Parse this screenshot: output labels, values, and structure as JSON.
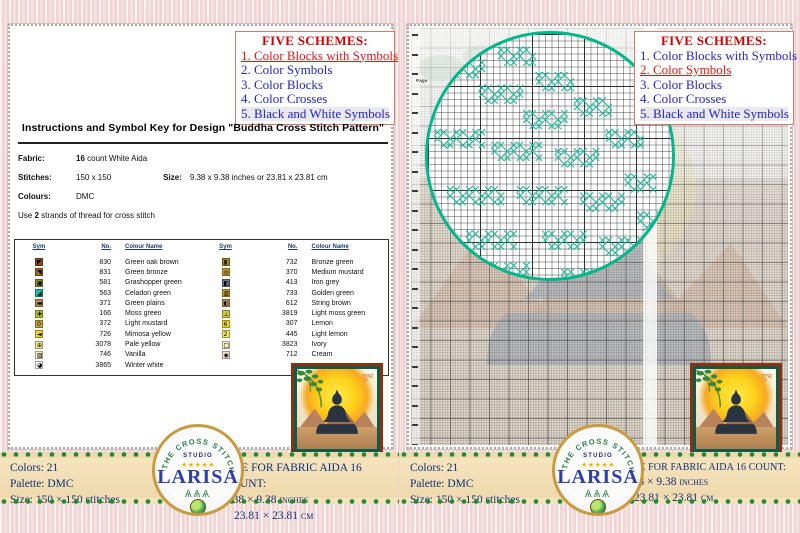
{
  "document": {
    "title": "Instructions and Symbol Key for Design \"Buddha Cross Stitch Pattern\"",
    "page_label": "Page"
  },
  "schemes": {
    "title": "FIVE SCHEMES:",
    "items_left": [
      "1. Color Blocks with Symbols",
      "2. Color Symbols",
      "3. Color Blocks",
      "4. Color Crosses",
      "5. Black and White Symbols"
    ],
    "items_right": [
      "1. Color Blocks with Symbols",
      "2. Color Symbols",
      "3. Color Blocks",
      "4. Color Crosses",
      "5. Black and White Symbols"
    ],
    "highlight_left_index": 0,
    "highlight_right_index": 1,
    "highlight_color": "#e81414",
    "item_color": "#2323cc",
    "title_color": "#d60000"
  },
  "specs": {
    "fabric_label": "Fabric:",
    "fabric_count": "16",
    "fabric_value": "count White Aida",
    "stitches_label": "Stitches:",
    "stitches_value": "150 x 150",
    "size_label": "Size:",
    "size_value": "9.38 x 9.38 inches or 23.81 x 23.81 cm",
    "colours_label": "Colours:",
    "colours_value": "DMC",
    "strands_prefix": "Use ",
    "strands_count": "2",
    "strands_suffix": " strands of thread for cross stitch"
  },
  "key_table": {
    "headers": {
      "sym": "Sym",
      "no": "No.",
      "name": "Colour Name"
    },
    "left_rows": [
      {
        "sym": "◤",
        "color": "#8a4a1e",
        "no": "830",
        "name": "Green oak brown"
      },
      {
        "sym": "◥",
        "color": "#a0662a",
        "no": "831",
        "name": "Green bronze"
      },
      {
        "sym": "▣",
        "color": "#8c8a1f",
        "no": "581",
        "name": "Grashopper green"
      },
      {
        "sym": "◢",
        "color": "#12c2a0",
        "no": "563",
        "name": "Celadon green"
      },
      {
        "sym": "▬",
        "color": "#b08a4e",
        "no": "371",
        "name": "Green plains"
      },
      {
        "sym": "✚",
        "color": "#b5c219",
        "no": "166",
        "name": "Moss green"
      },
      {
        "sym": "0",
        "color": "#c9a63a",
        "no": "372",
        "name": "Light mustard"
      },
      {
        "sym": "◄",
        "color": "#f4cf1e",
        "no": "726",
        "name": "Mimosa yellow"
      },
      {
        "sym": "⊕",
        "color": "#f0e48c",
        "no": "3078",
        "name": "Pale yellow"
      },
      {
        "sym": "▨",
        "color": "#f7f1c8",
        "no": "746",
        "name": "Vanilla"
      },
      {
        "sym": "◕",
        "color": "#fafafa",
        "no": "3865",
        "name": "Winter white"
      }
    ],
    "right_rows": [
      {
        "sym": "▮",
        "color": "#9c8a22",
        "no": "732",
        "name": "Bronze green"
      },
      {
        "sym": "◎",
        "color": "#c79a2e",
        "no": "370",
        "name": "Medium mustard"
      },
      {
        "sym": "◧",
        "color": "#6e7d8c",
        "no": "413",
        "name": "Iron grey"
      },
      {
        "sym": "▥",
        "color": "#c8a02c",
        "no": "733",
        "name": "Golden green"
      },
      {
        "sym": "◐",
        "color": "#b08a52",
        "no": "612",
        "name": "String brown"
      },
      {
        "sym": "⊥",
        "color": "#d4c84a",
        "no": "3819",
        "name": "Light moss green"
      },
      {
        "sym": "6",
        "color": "#f6d71c",
        "no": "307",
        "name": "Lemon"
      },
      {
        "sym": "2",
        "color": "#f8e463",
        "no": "445",
        "name": "Light lemon"
      },
      {
        "sym": "□",
        "color": "#f5eec4",
        "no": "3823",
        "name": "Ivory"
      },
      {
        "sym": "◉",
        "color": "#f3e7cc",
        "no": "712",
        "name": "Cream"
      }
    ]
  },
  "footer_left": {
    "colors_line": "Colors: 21",
    "palette_line": "Palette: DMC",
    "size_line": "Size: 150 × 150 stitches"
  },
  "footer_left_right": {
    "size_title": "SIZE FOR FABRIC AIDA 16 COUNT:",
    "inches": "9.38 × 9.38 inches",
    "cm": "23.81 ×  23.81 cm"
  },
  "footer_right": {
    "colors_line": "Colors: 21",
    "palette_line": "Palette: DMC",
    "size_line": "Size: 150 × 150 stitches"
  },
  "footer_right_right": {
    "size_title": "SIZE FOR FABRIC AIDA 16 COUNT:",
    "inches": "9.38 × 9.38 inches",
    "cm": "23.81 ×  23.81 cm"
  },
  "logo": {
    "arc_text": "THE CROSS STITCH",
    "studio": "STUDIO",
    "stars": "★★★★★",
    "name": "LARISA",
    "swirl": "ѦѦѦ"
  },
  "preview": {
    "alt": "Buddha cross stitch preview",
    "om_glyph": "शुभ"
  },
  "colors": {
    "accent_green": "#00b88a",
    "footer_bg": "#f3ddb2",
    "footer_text": "#0f2f7a",
    "frame_outer": "#8a3210",
    "frame_inner": "#0f5a4a"
  }
}
